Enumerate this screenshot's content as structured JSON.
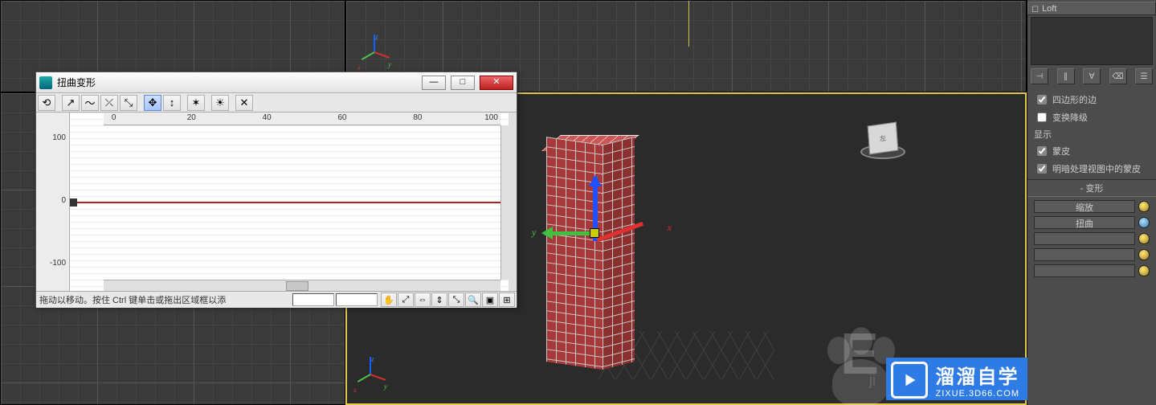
{
  "dialog": {
    "title": "扭曲变形",
    "hruler": [
      "0",
      "20",
      "40",
      "60",
      "80",
      "100"
    ],
    "vruler_top": "100",
    "vruler_mid": "0",
    "vruler_bot": "-100",
    "status_hint": "拖动以移动。按住 Ctrl 键单击或拖出区域框以添"
  },
  "panel": {
    "loft_label": "Loft",
    "opt_quad": "四边形的边",
    "opt_degrade": "变换降级",
    "display_header": "显示",
    "opt_skin": "蒙皮",
    "opt_skin_shaded": "明暗处理视图中的蒙皮",
    "deform_header": "变形",
    "deform_btn_1": "缩放",
    "deform_btn_2": "扭曲"
  },
  "viewcube": {
    "face": "左"
  },
  "axes": {
    "x": "x",
    "y": "y",
    "z": "z"
  },
  "watermark": {
    "brand": "溜溜自学",
    "url": "ZIXUE.3D66.COM",
    "baidu_letter": "E",
    "baidu_ji": "ji"
  }
}
